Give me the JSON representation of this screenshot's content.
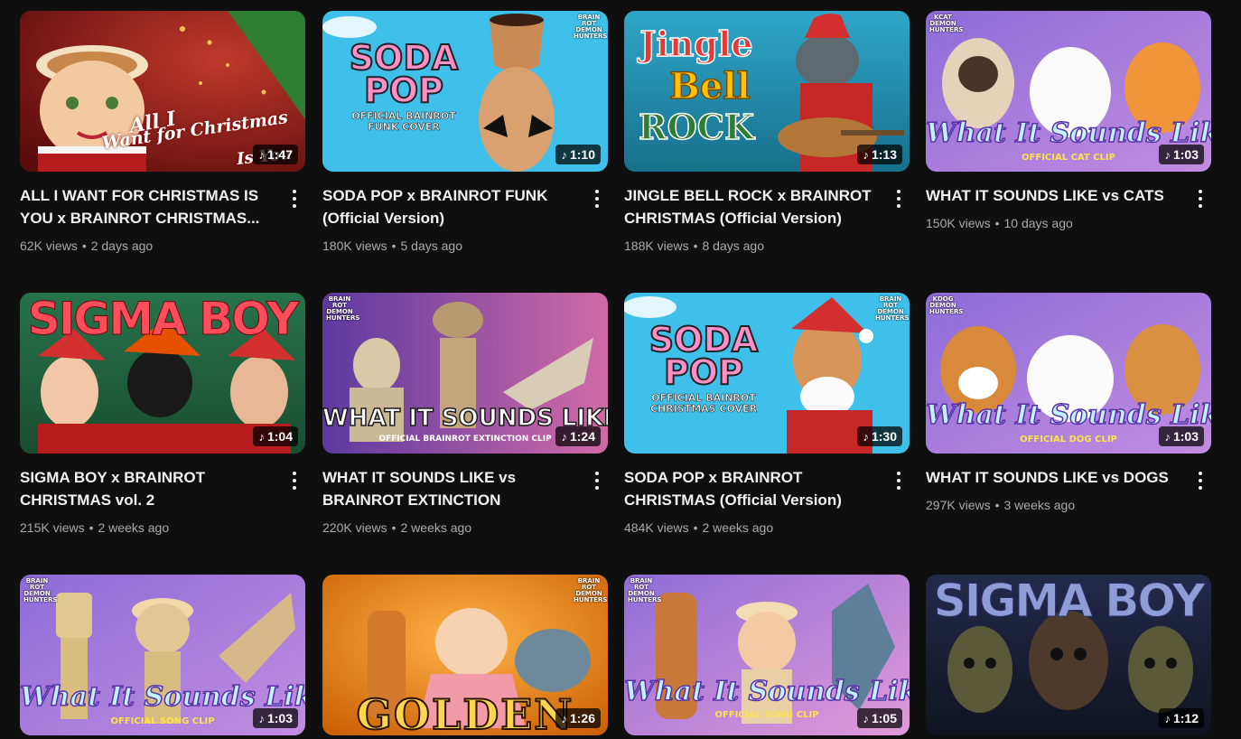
{
  "videos": [
    {
      "title": "ALL I WANT FOR CHRISTMAS IS YOU x BRAINROT CHRISTMAS...",
      "views": "62K views",
      "age": "2 days ago",
      "duration": "1:47",
      "thumb_text": [
        "All I",
        "Want for Christmas",
        "Is You"
      ]
    },
    {
      "title": "SODA POP x BRAINROT FUNK (Official Version)",
      "views": "180K views",
      "age": "5 days ago",
      "duration": "1:10",
      "thumb_text": [
        "SODA",
        "POP",
        "OFFICIAL BAINROT",
        "FUNK COVER"
      ],
      "badge": [
        "BRAIN",
        "ROT",
        "DEMON",
        "HUNTERS"
      ]
    },
    {
      "title": "JINGLE BELL ROCK x BRAINROT CHRISTMAS (Official Version)",
      "views": "188K views",
      "age": "8 days ago",
      "duration": "1:13",
      "thumb_text": [
        "Jingle",
        "Bell",
        "ROCK"
      ]
    },
    {
      "title": "WHAT IT SOUNDS LIKE vs CATS",
      "views": "150K views",
      "age": "10 days ago",
      "duration": "1:03",
      "thumb_text": [
        "What It Sounds Like",
        "OFFICIAL CAT CLIP"
      ],
      "badge": [
        "KCAT",
        "DEMON",
        "HUNTERS"
      ]
    },
    {
      "title": "SIGMA BOY x BRAINROT CHRISTMAS vol. 2",
      "views": "215K views",
      "age": "2 weeks ago",
      "duration": "1:04",
      "thumb_text": [
        "SIGMA BOY"
      ]
    },
    {
      "title": "WHAT IT SOUNDS LIKE vs BRAINROT EXTINCTION",
      "views": "220K views",
      "age": "2 weeks ago",
      "duration": "1:24",
      "thumb_text": [
        "WHAT IT SOUNDS LIKE",
        "OFFICIAL BRAINROT EXTINCTION CLIP"
      ],
      "badge": [
        "BRAIN",
        "ROT",
        "DEMON",
        "HUNTERS"
      ]
    },
    {
      "title": "SODA POP x BRAINROT CHRISTMAS (Official Version)",
      "views": "484K views",
      "age": "2 weeks ago",
      "duration": "1:30",
      "thumb_text": [
        "SODA",
        "POP",
        "OFFICIAL BAINROT",
        "CHRISTMAS COVER"
      ],
      "badge": [
        "BRAIN",
        "ROT",
        "DEMON",
        "HUNTERS"
      ]
    },
    {
      "title": "WHAT IT SOUNDS LIKE vs DOGS",
      "views": "297K views",
      "age": "3 weeks ago",
      "duration": "1:03",
      "thumb_text": [
        "What It Sounds Like",
        "OFFICIAL DOG CLIP"
      ],
      "badge": [
        "KDOG",
        "DEMON",
        "HUNTERS"
      ]
    },
    {
      "title": "",
      "views": "",
      "age": "",
      "duration": "1:03",
      "thumb_text": [
        "What It Sounds Like",
        "OFFICIAL SONG CLIP"
      ],
      "badge": [
        "BRAIN",
        "ROT",
        "DEMON",
        "HUNTERS"
      ]
    },
    {
      "title": "",
      "views": "",
      "age": "",
      "duration": "1:26",
      "thumb_text": [
        "GOLDEN"
      ],
      "badge": [
        "BRAIN",
        "ROT",
        "DEMON",
        "HUNTERS"
      ]
    },
    {
      "title": "",
      "views": "",
      "age": "",
      "duration": "1:05",
      "thumb_text": [
        "What It Sounds Like",
        "OFFICIAL SONG CLIP"
      ],
      "badge": [
        "BRAIN",
        "ROT",
        "DEMON",
        "HUNTERS"
      ]
    },
    {
      "title": "",
      "views": "",
      "age": "",
      "duration": "1:12",
      "thumb_text": [
        "SIGMA BOY"
      ]
    }
  ],
  "meta_separator": "•",
  "duration_icon": "music-note-icon",
  "menu_icon": "more-vert-icon",
  "colors": {
    "background": "#0f0f0f",
    "title": "#f1f1f1",
    "meta": "#aaaaaa"
  }
}
